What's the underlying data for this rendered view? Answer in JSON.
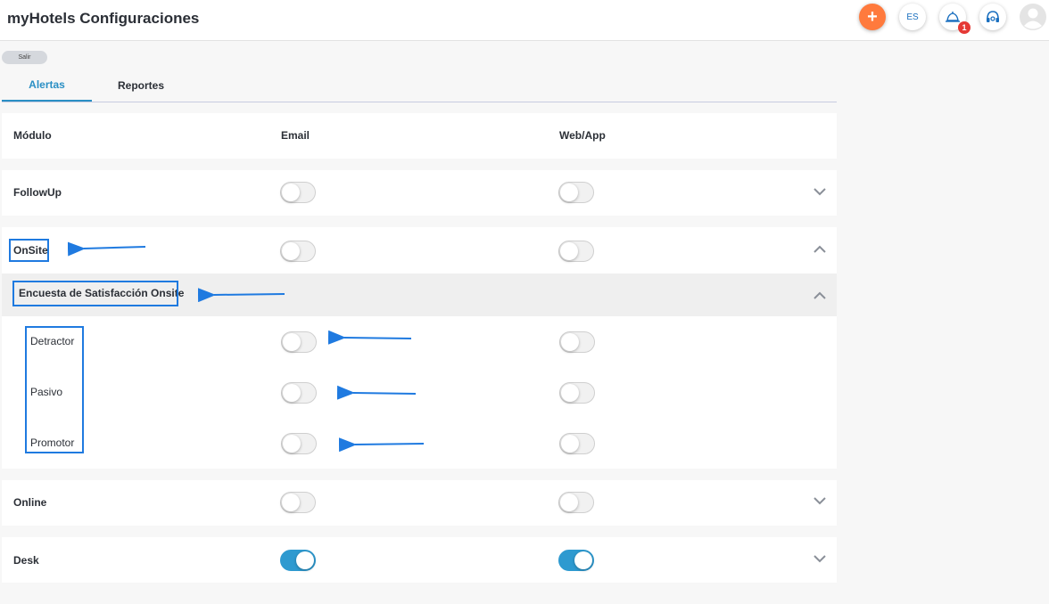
{
  "app": {
    "title": "myHotels Configuraciones"
  },
  "header": {
    "add_icon": "+",
    "language": "ES",
    "notification_count": "1",
    "icons": [
      "plus-icon",
      "bell-icon",
      "headset-icon",
      "user-avatar-icon"
    ]
  },
  "exit_button": {
    "label": "Salir"
  },
  "tabs": [
    {
      "label": "Alertas",
      "active": true
    },
    {
      "label": "Reportes",
      "active": false
    }
  ],
  "table": {
    "headers": {
      "module": "Módulo",
      "email": "Email",
      "webapp": "Web/App"
    },
    "modules": [
      {
        "name": "FollowUp",
        "email_on": false,
        "webapp_on": false,
        "expanded": false
      },
      {
        "name": "OnSite",
        "email_on": false,
        "webapp_on": false,
        "expanded": true,
        "submodule": {
          "name": "Encuesta de Satisfacción Onsite",
          "expanded": true,
          "items": [
            {
              "name": "Detractor",
              "email_on": false,
              "webapp_on": false
            },
            {
              "name": "Pasivo",
              "email_on": false,
              "webapp_on": false
            },
            {
              "name": "Promotor",
              "email_on": false,
              "webapp_on": false
            }
          ]
        }
      },
      {
        "name": "Online",
        "email_on": false,
        "webapp_on": false,
        "expanded": false
      },
      {
        "name": "Desk",
        "email_on": true,
        "webapp_on": true,
        "expanded": false
      }
    ]
  },
  "colors": {
    "accent": "#2a8fc4",
    "add_button": "#ff7a3d",
    "badge": "#e53935",
    "annotation": "#1f7ae0",
    "toggle_on": "#2e9ad0"
  }
}
